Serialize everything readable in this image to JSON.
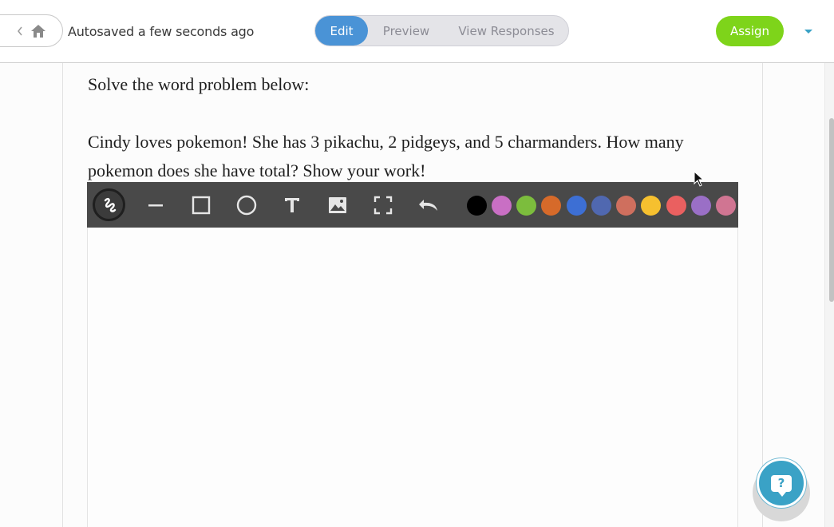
{
  "header": {
    "autosave_text": "Autosaved a few seconds ago",
    "tabs": [
      {
        "label": "Edit",
        "active": true
      },
      {
        "label": "Preview",
        "active": false
      },
      {
        "label": "View Responses",
        "active": false
      }
    ],
    "assign_label": "Assign"
  },
  "question": {
    "line1": "Solve the word problem below:",
    "line2": "Cindy loves pokemon! She has 3 pikachu, 2 pidgeys, and 5 charmanders. How many pokemon does she have total? Show your work!"
  },
  "toolbar": {
    "tools": [
      "freehand-icon",
      "line-icon",
      "rectangle-icon",
      "circle-icon",
      "text-icon",
      "image-icon",
      "fullscreen-icon",
      "undo-icon"
    ],
    "colors": [
      "#000000",
      "#c96fc4",
      "#7cbd3d",
      "#d66a2a",
      "#3d6fd4",
      "#5068b0",
      "#cf6f5e",
      "#f6c02f",
      "#ea6060",
      "#9a6fc6",
      "#d07592"
    ]
  },
  "help": {
    "icon": "help-question-icon",
    "symbol": "?"
  },
  "colors": {
    "accent": "#4a93d6",
    "assign": "#7ed41a",
    "help": "#3aa2c6"
  }
}
